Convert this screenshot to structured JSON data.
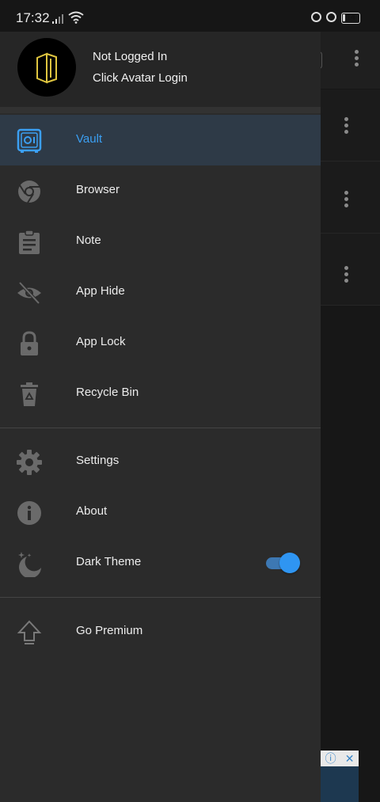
{
  "status_bar": {
    "time": "17:32",
    "battery": "14"
  },
  "drawer": {
    "header": {
      "line1": "Not Logged In",
      "line2": "Click Avatar Login"
    },
    "items": [
      {
        "label": "Vault",
        "icon": "vault-icon",
        "active": true
      },
      {
        "label": "Browser",
        "icon": "browser-icon"
      },
      {
        "label": "Note",
        "icon": "note-clipboard-icon"
      },
      {
        "label": "App Hide",
        "icon": "eye-off-icon"
      },
      {
        "label": "App Lock",
        "icon": "lock-icon"
      },
      {
        "label": "Recycle Bin",
        "icon": "recycle-bin-icon"
      }
    ],
    "settings_items": [
      {
        "label": "Settings",
        "icon": "gear-icon"
      },
      {
        "label": "About",
        "icon": "info-icon"
      },
      {
        "label": "Dark Theme",
        "icon": "moon-stars-icon",
        "toggle_on": true
      }
    ],
    "premium": {
      "label": "Go Premium",
      "icon": "upload-arrow-icon"
    }
  },
  "colors": {
    "accent": "#3b9ff2",
    "drawer_bg": "#2b2b2b",
    "active_bg": "#2e3a47"
  }
}
